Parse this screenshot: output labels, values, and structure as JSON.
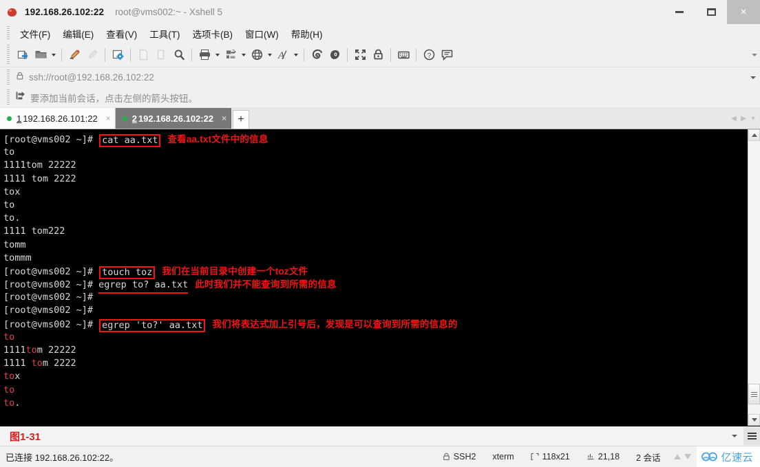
{
  "window": {
    "ip_title": "192.168.26.102:22",
    "session_title": "root@vms002:~ - Xshell 5",
    "app_icon": "xshell-ball-icon",
    "minimize_label": "–",
    "maximize_label": "❐",
    "close_label": "×"
  },
  "menu": {
    "items": [
      {
        "label": "文件(F)",
        "name": "menu-file"
      },
      {
        "label": "编辑(E)",
        "name": "menu-edit"
      },
      {
        "label": "查看(V)",
        "name": "menu-view"
      },
      {
        "label": "工具(T)",
        "name": "menu-tools"
      },
      {
        "label": "选项卡(B)",
        "name": "menu-tabs"
      },
      {
        "label": "窗口(W)",
        "name": "menu-window"
      },
      {
        "label": "帮助(H)",
        "name": "menu-help"
      }
    ]
  },
  "toolbar": {
    "icons": [
      "new-session-icon",
      "open-folder-icon",
      "folder-dropdown-caret",
      "sep-1",
      "highlight-pen-icon",
      "pen-disabled-icon",
      "sep-2",
      "session-properties-icon",
      "sep-3",
      "copy-disabled-icon",
      "paste-disabled-icon",
      "find-icon",
      "sep-4",
      "print-icon",
      "print-dropdown-caret",
      "transfer-file-icon",
      "transfer-dropdown-caret",
      "globe-icon",
      "globe-dropdown-caret",
      "font-icon",
      "font-dropdown-caret",
      "sep-5",
      "xftp-icon",
      "xagent-icon",
      "sep-6",
      "fullscreen-icon",
      "lock-icon",
      "sep-7",
      "keyboard-icon",
      "sep-8",
      "help-icon",
      "comment-icon"
    ],
    "overflow_caret": "toolbar-overflow-caret"
  },
  "address_bar": {
    "lock_icon": "lock-icon",
    "value": "ssh://root@192.168.26.102:22",
    "placeholder": "ssh://",
    "dropdown_caret": "address-dropdown-caret"
  },
  "hint_bar": {
    "icon": "add-session-arrow-icon",
    "text": "要添加当前会话，点击左侧的箭头按钮。"
  },
  "tabs": {
    "items": [
      {
        "num": "1",
        "label": "192.168.26.101:22",
        "active": false,
        "close": "×",
        "status": "connected"
      },
      {
        "num": "2",
        "label": "192.168.26.102:22",
        "active": true,
        "close": "×",
        "status": "connected"
      }
    ],
    "add_label": "+",
    "scroll_left": "◀",
    "scroll_right": "▶",
    "list_caret": "▾"
  },
  "terminal": {
    "prompt": "[root@vms002 ~]# ",
    "lines": [
      {
        "type": "cmd",
        "prompt": "[root@vms002 ~]# ",
        "cmd": "cat aa.txt",
        "mark": "box",
        "annot": "查看aa.txt文件中的信息"
      },
      {
        "type": "out",
        "segs": [
          {
            "t": "to",
            "c": "w"
          }
        ]
      },
      {
        "type": "out",
        "segs": [
          {
            "t": "1111tom 22222",
            "c": "w"
          }
        ]
      },
      {
        "type": "out",
        "segs": [
          {
            "t": "1111 tom 2222",
            "c": "w"
          }
        ]
      },
      {
        "type": "out",
        "segs": [
          {
            "t": "tox",
            "c": "w"
          }
        ]
      },
      {
        "type": "out",
        "segs": [
          {
            "t": "to",
            "c": "w"
          }
        ]
      },
      {
        "type": "out",
        "segs": [
          {
            "t": "to.",
            "c": "w"
          }
        ]
      },
      {
        "type": "out",
        "segs": [
          {
            "t": "1111 tom222",
            "c": "w"
          }
        ]
      },
      {
        "type": "out",
        "segs": [
          {
            "t": "tomm",
            "c": "w"
          }
        ]
      },
      {
        "type": "out",
        "segs": [
          {
            "t": "tommm",
            "c": "w"
          }
        ]
      },
      {
        "type": "cmd",
        "prompt": "[root@vms002 ~]# ",
        "cmd": "touch toz",
        "mark": "box",
        "annot": "我们在当前目录中创建一个toz文件"
      },
      {
        "type": "cmd",
        "prompt": "[root@vms002 ~]# ",
        "cmd": "egrep to? aa.txt",
        "mark": "underline",
        "annot": "此时我们并不能查询到所需的信息"
      },
      {
        "type": "cmd",
        "prompt": "[root@vms002 ~]# ",
        "cmd": "",
        "mark": "none",
        "annot": ""
      },
      {
        "type": "cmd",
        "prompt": "[root@vms002 ~]# ",
        "cmd": "",
        "mark": "none",
        "annot": ""
      },
      {
        "type": "cmd",
        "prompt": "[root@vms002 ~]# ",
        "cmd": "egrep 'to?' aa.txt",
        "mark": "box",
        "annot": "我们将表达式加上引号后，发现是可以查询到所需的信息的"
      },
      {
        "type": "out",
        "segs": [
          {
            "t": "to",
            "c": "m"
          }
        ]
      },
      {
        "type": "out",
        "segs": [
          {
            "t": "1111",
            "c": "w"
          },
          {
            "t": "to",
            "c": "m"
          },
          {
            "t": "m 22222",
            "c": "w"
          }
        ]
      },
      {
        "type": "out",
        "segs": [
          {
            "t": "1111 ",
            "c": "w"
          },
          {
            "t": "to",
            "c": "m"
          },
          {
            "t": "m 2222",
            "c": "w"
          }
        ]
      },
      {
        "type": "out",
        "segs": [
          {
            "t": "to",
            "c": "m"
          },
          {
            "t": "x",
            "c": "w"
          }
        ]
      },
      {
        "type": "out",
        "segs": [
          {
            "t": "to",
            "c": "m"
          }
        ]
      },
      {
        "type": "out",
        "segs": [
          {
            "t": "to",
            "c": "m"
          },
          {
            "t": ".",
            "c": "w"
          }
        ]
      }
    ],
    "scrollbar": {
      "up": "scroll-up-arrow",
      "down": "scroll-down-arrow",
      "thumb": "scroll-thumb"
    }
  },
  "caption": {
    "text": "图1-31",
    "caret": "caption-dropdown-caret",
    "menu": "caption-menu-icon"
  },
  "status": {
    "connection": "已连接 192.168.26.102:22。",
    "protocol": "SSH2",
    "terminal_type": "xterm",
    "size": "118x21",
    "cursor": "21,18",
    "sessions": "2 会话",
    "watermark": "亿速云"
  },
  "colors": {
    "accent_red": "#fc1111",
    "annotation_red": "#f41414",
    "terminal_bg": "#000000",
    "terminal_fg": "#d8d8d8",
    "match_red": "#e04545",
    "tab_active_bg": "#787878",
    "green_dot": "#22b14c",
    "watermark_blue": "#4aa3df",
    "chrome_bg": "#f0f0f0"
  }
}
